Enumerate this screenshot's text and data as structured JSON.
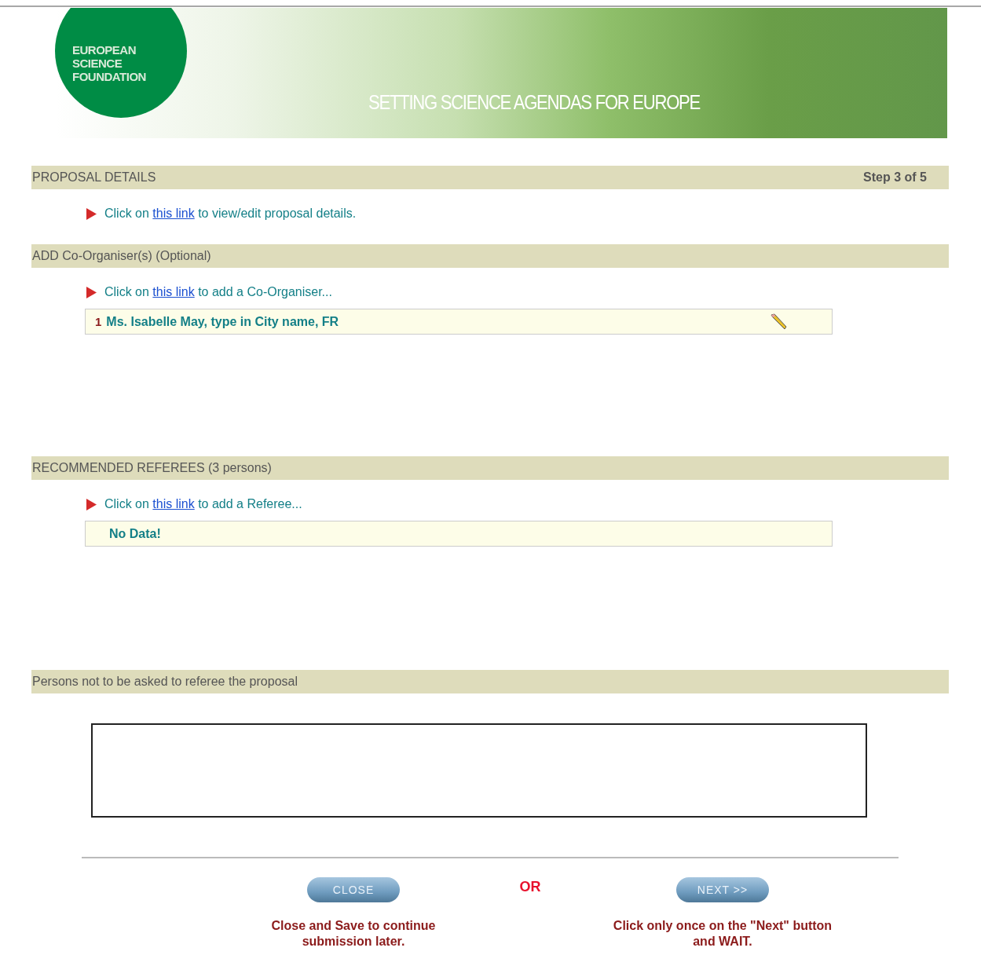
{
  "banner": {
    "logo_lines": [
      "EUROPEAN",
      "SCIENCE",
      "FOUNDATION"
    ],
    "tagline": "SETTING SCIENCE AGENDAS FOR EUROPE"
  },
  "sections": [
    {
      "kind": "details",
      "title": "PROPOSAL DETAILS",
      "step": "Step 3 of 5",
      "instruction": {
        "before": "Click on",
        "link": "this link",
        "after": "to view/edit proposal details."
      }
    },
    {
      "kind": "list",
      "title": "ADD Co-Organiser(s) (Optional)",
      "instruction": {
        "before": "Click on",
        "link": "this link",
        "after": "to add a Co-Organiser..."
      },
      "rows": [
        {
          "number": "1",
          "text": "Ms. Isabelle May, type in City name, FR"
        }
      ]
    },
    {
      "kind": "list",
      "title": "RECOMMENDED REFEREES (3 persons)",
      "instruction": {
        "before": "Click on",
        "link": "this link",
        "after": "to add a Referee..."
      },
      "empty_text": "No Data!"
    },
    {
      "kind": "textarea",
      "title": "Persons not to be asked to referee the proposal"
    }
  ],
  "footer": {
    "close_button": "CLOSE",
    "close_note": "Close and Save to continue submission later.",
    "or": "OR",
    "next_button": "NEXT >>",
    "next_note": "Click only once on the \"Next\" button and WAIT."
  }
}
